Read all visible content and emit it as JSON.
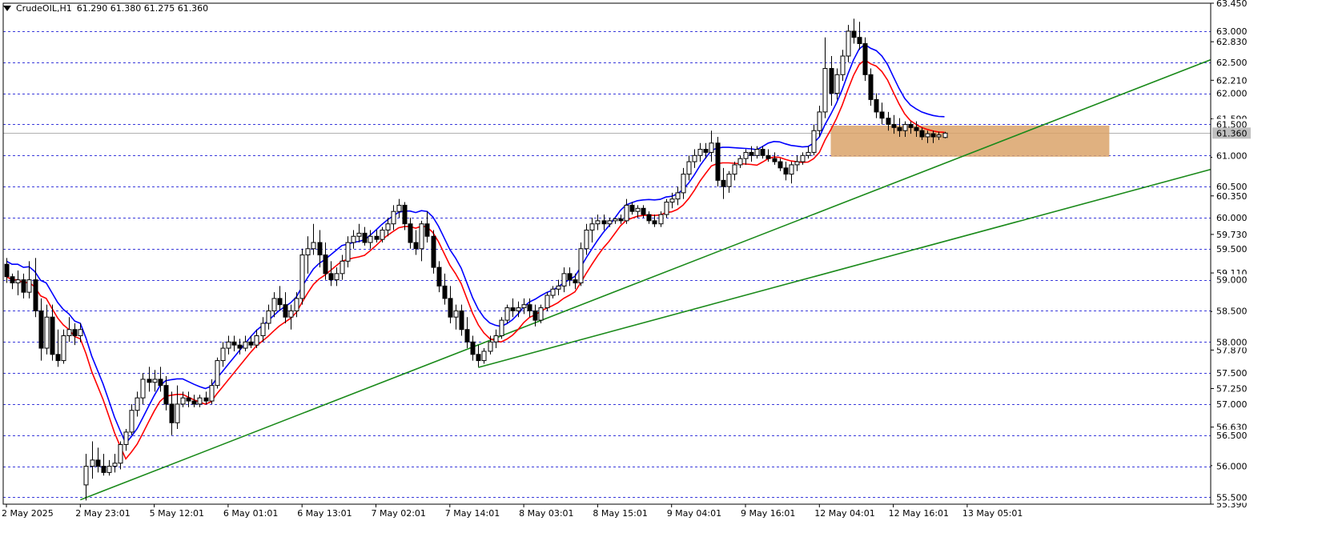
{
  "header": {
    "symbol": "CrudeOIL,H1",
    "ohlc": "61.290 61.380 61.275 61.360"
  },
  "chart_data": {
    "type": "candlestick",
    "ylim": [
      55.39,
      63.45
    ],
    "current_price": "61.360",
    "y_ticks": [
      "63.450",
      "62.830",
      "62.210",
      "61.590",
      "60.970",
      "60.350",
      "59.730",
      "59.110",
      "58.490",
      "57.870",
      "57.250",
      "56.630",
      "56.010",
      "55.390"
    ],
    "levels": [
      "63.000",
      "62.500",
      "62.000",
      "61.500",
      "61.000",
      "60.500",
      "60.000",
      "59.500",
      "59.000",
      "58.500",
      "58.000",
      "57.500",
      "57.000",
      "56.500",
      "56.000",
      "55.500"
    ],
    "x_labels": [
      "2 May 2025",
      "2 May 23:01",
      "5 May 12:01",
      "6 May 01:01",
      "6 May 13:01",
      "7 May 02:01",
      "7 May 14:01",
      "8 May 03:01",
      "8 May 15:01",
      "9 May 04:01",
      "9 May 16:01",
      "12 May 04:01",
      "12 May 16:01",
      "13 May 05:01"
    ],
    "x_label_bars": [
      0,
      13,
      26,
      39,
      52,
      65,
      78,
      91,
      104,
      117,
      130,
      143,
      156,
      169
    ],
    "candles": [
      [
        59.25,
        59.35,
        58.95,
        59.05
      ],
      [
        59.05,
        59.1,
        58.85,
        58.95
      ],
      [
        58.95,
        59.15,
        58.75,
        59.0
      ],
      [
        59.0,
        59.1,
        58.7,
        58.8
      ],
      [
        58.8,
        59.3,
        58.7,
        59.0
      ],
      [
        59.0,
        59.35,
        58.4,
        58.5
      ],
      [
        58.5,
        58.7,
        57.7,
        57.9
      ],
      [
        57.9,
        58.6,
        57.8,
        58.4
      ],
      [
        58.4,
        58.6,
        57.7,
        57.8
      ],
      [
        57.8,
        58.2,
        57.6,
        57.7
      ],
      [
        57.7,
        58.2,
        57.65,
        58.1
      ],
      [
        58.1,
        58.4,
        58.0,
        58.2
      ],
      [
        58.2,
        58.3,
        57.95,
        58.1
      ],
      [
        58.1,
        58.3,
        58.0,
        58.2
      ],
      [
        55.7,
        56.2,
        55.45,
        56.0
      ],
      [
        56.0,
        56.4,
        55.8,
        56.1
      ],
      [
        56.1,
        56.3,
        55.9,
        56.0
      ],
      [
        56.0,
        56.2,
        55.85,
        55.9
      ],
      [
        55.9,
        56.1,
        55.85,
        56.0
      ],
      [
        56.0,
        56.2,
        55.9,
        56.05
      ],
      [
        56.05,
        56.4,
        55.95,
        56.35
      ],
      [
        56.35,
        56.6,
        56.25,
        56.55
      ],
      [
        56.55,
        57.0,
        56.5,
        56.9
      ],
      [
        56.9,
        57.2,
        56.8,
        57.1
      ],
      [
        57.1,
        57.5,
        57.0,
        57.4
      ],
      [
        57.4,
        57.6,
        57.2,
        57.35
      ],
      [
        57.35,
        57.55,
        57.2,
        57.4
      ],
      [
        57.4,
        57.6,
        57.2,
        57.3
      ],
      [
        57.3,
        57.45,
        56.9,
        57.0
      ],
      [
        57.0,
        57.2,
        56.5,
        56.7
      ],
      [
        56.7,
        57.3,
        56.6,
        57.0
      ],
      [
        57.0,
        57.2,
        56.95,
        57.1
      ],
      [
        57.1,
        57.2,
        56.95,
        57.05
      ],
      [
        57.05,
        57.15,
        56.95,
        57.0
      ],
      [
        57.0,
        57.15,
        56.95,
        57.1
      ],
      [
        57.1,
        57.2,
        57.0,
        57.05
      ],
      [
        57.05,
        57.4,
        57.0,
        57.3
      ],
      [
        57.3,
        57.75,
        57.25,
        57.7
      ],
      [
        57.7,
        58.0,
        57.6,
        57.9
      ],
      [
        57.9,
        58.1,
        57.8,
        58.0
      ],
      [
        58.0,
        58.1,
        57.85,
        57.95
      ],
      [
        57.95,
        58.05,
        57.8,
        57.9
      ],
      [
        57.9,
        58.1,
        57.85,
        58.0
      ],
      [
        58.0,
        58.1,
        57.9,
        57.95
      ],
      [
        57.95,
        58.2,
        57.9,
        58.1
      ],
      [
        58.1,
        58.4,
        58.0,
        58.3
      ],
      [
        58.3,
        58.6,
        58.2,
        58.5
      ],
      [
        58.5,
        58.8,
        58.4,
        58.7
      ],
      [
        58.7,
        58.9,
        58.5,
        58.6
      ],
      [
        58.6,
        58.8,
        58.3,
        58.4
      ],
      [
        58.4,
        58.6,
        58.2,
        58.5
      ],
      [
        58.5,
        58.8,
        58.4,
        58.7
      ],
      [
        58.7,
        59.5,
        58.6,
        59.4
      ],
      [
        59.4,
        59.7,
        59.1,
        59.5
      ],
      [
        59.5,
        59.9,
        59.4,
        59.6
      ],
      [
        59.6,
        59.8,
        59.2,
        59.4
      ],
      [
        59.4,
        59.6,
        59.0,
        59.1
      ],
      [
        59.1,
        59.3,
        58.9,
        59.0
      ],
      [
        59.0,
        59.2,
        58.9,
        59.1
      ],
      [
        59.1,
        59.4,
        59.0,
        59.3
      ],
      [
        59.3,
        59.7,
        59.2,
        59.6
      ],
      [
        59.6,
        59.8,
        59.5,
        59.7
      ],
      [
        59.7,
        59.9,
        59.6,
        59.75
      ],
      [
        59.75,
        59.85,
        59.55,
        59.6
      ],
      [
        59.6,
        59.8,
        59.5,
        59.7
      ],
      [
        59.7,
        59.8,
        59.6,
        59.65
      ],
      [
        59.65,
        59.85,
        59.6,
        59.8
      ],
      [
        59.8,
        60.0,
        59.7,
        59.9
      ],
      [
        59.9,
        60.2,
        59.8,
        60.1
      ],
      [
        60.1,
        60.3,
        60.0,
        60.2
      ],
      [
        60.2,
        60.25,
        59.8,
        59.9
      ],
      [
        59.9,
        60.0,
        59.5,
        59.6
      ],
      [
        59.6,
        59.8,
        59.4,
        59.5
      ],
      [
        59.5,
        59.95,
        59.3,
        59.9
      ],
      [
        59.9,
        60.1,
        59.6,
        59.7
      ],
      [
        59.7,
        59.8,
        59.1,
        59.2
      ],
      [
        59.2,
        59.3,
        58.8,
        58.9
      ],
      [
        58.9,
        59.1,
        58.6,
        58.7
      ],
      [
        58.7,
        58.9,
        58.3,
        58.4
      ],
      [
        58.4,
        58.6,
        58.2,
        58.5
      ],
      [
        58.5,
        58.6,
        58.1,
        58.2
      ],
      [
        58.2,
        58.4,
        57.9,
        58.0
      ],
      [
        58.0,
        58.1,
        57.7,
        57.8
      ],
      [
        57.8,
        57.95,
        57.6,
        57.7
      ],
      [
        57.7,
        57.9,
        57.65,
        57.85
      ],
      [
        57.85,
        58.1,
        57.8,
        58.0
      ],
      [
        58.0,
        58.2,
        57.9,
        58.1
      ],
      [
        58.1,
        58.4,
        58.05,
        58.35
      ],
      [
        58.35,
        58.6,
        58.3,
        58.55
      ],
      [
        58.55,
        58.7,
        58.4,
        58.5
      ],
      [
        58.5,
        58.65,
        58.4,
        58.55
      ],
      [
        58.55,
        58.7,
        58.45,
        58.6
      ],
      [
        58.6,
        58.7,
        58.4,
        58.5
      ],
      [
        58.5,
        58.6,
        58.25,
        58.35
      ],
      [
        58.35,
        58.6,
        58.3,
        58.55
      ],
      [
        58.55,
        58.8,
        58.5,
        58.75
      ],
      [
        58.75,
        58.9,
        58.7,
        58.85
      ],
      [
        58.85,
        59.0,
        58.75,
        58.9
      ],
      [
        58.9,
        59.2,
        58.8,
        59.1
      ],
      [
        59.1,
        59.2,
        58.9,
        59.0
      ],
      [
        59.0,
        59.1,
        58.85,
        58.95
      ],
      [
        58.95,
        59.6,
        58.9,
        59.5
      ],
      [
        59.5,
        59.9,
        59.4,
        59.8
      ],
      [
        59.8,
        60.0,
        59.6,
        59.9
      ],
      [
        59.9,
        60.05,
        59.8,
        59.95
      ],
      [
        59.95,
        60.05,
        59.8,
        59.9
      ],
      [
        59.9,
        60.0,
        59.85,
        59.95
      ],
      [
        59.95,
        60.0,
        59.9,
        59.98
      ],
      [
        59.98,
        60.05,
        59.9,
        59.95
      ],
      [
        59.95,
        60.3,
        59.9,
        60.2
      ],
      [
        60.2,
        60.25,
        60.05,
        60.1
      ],
      [
        60.1,
        60.2,
        60.0,
        60.15
      ],
      [
        60.15,
        60.2,
        60.0,
        60.05
      ],
      [
        60.05,
        60.1,
        59.9,
        59.95
      ],
      [
        59.95,
        60.05,
        59.85,
        59.9
      ],
      [
        59.9,
        60.1,
        59.85,
        60.05
      ],
      [
        60.05,
        60.3,
        60.0,
        60.25
      ],
      [
        60.25,
        60.4,
        60.15,
        60.3
      ],
      [
        60.3,
        60.5,
        60.2,
        60.4
      ],
      [
        60.4,
        60.8,
        60.3,
        60.7
      ],
      [
        60.7,
        61.0,
        60.6,
        60.9
      ],
      [
        60.9,
        61.1,
        60.8,
        61.0
      ],
      [
        61.0,
        61.2,
        60.9,
        61.1
      ],
      [
        61.1,
        61.2,
        60.95,
        61.05
      ],
      [
        61.05,
        61.4,
        60.9,
        61.2
      ],
      [
        61.2,
        61.3,
        60.5,
        60.6
      ],
      [
        60.6,
        60.8,
        60.3,
        60.5
      ],
      [
        60.5,
        60.75,
        60.4,
        60.7
      ],
      [
        60.7,
        60.9,
        60.6,
        60.85
      ],
      [
        60.85,
        61.0,
        60.8,
        60.95
      ],
      [
        60.95,
        61.1,
        60.85,
        61.05
      ],
      [
        61.05,
        61.15,
        60.9,
        61.0
      ],
      [
        61.0,
        61.15,
        60.95,
        61.1
      ],
      [
        61.1,
        61.15,
        60.95,
        61.0
      ],
      [
        61.0,
        61.1,
        60.9,
        60.95
      ],
      [
        60.95,
        61.05,
        60.85,
        60.9
      ],
      [
        60.9,
        60.95,
        60.75,
        60.8
      ],
      [
        60.8,
        60.9,
        60.6,
        60.7
      ],
      [
        60.7,
        60.9,
        60.55,
        60.85
      ],
      [
        60.85,
        61.0,
        60.75,
        60.9
      ],
      [
        60.9,
        61.05,
        60.85,
        61.0
      ],
      [
        61.0,
        61.15,
        60.95,
        61.05
      ],
      [
        61.05,
        61.5,
        61.0,
        61.4
      ],
      [
        61.4,
        61.8,
        61.3,
        61.7
      ],
      [
        61.7,
        62.9,
        61.6,
        62.4
      ],
      [
        62.4,
        62.6,
        61.8,
        62.0
      ],
      [
        62.0,
        62.4,
        61.9,
        62.3
      ],
      [
        62.3,
        62.7,
        62.2,
        62.6
      ],
      [
        62.6,
        63.1,
        62.5,
        63.0
      ],
      [
        63.0,
        63.2,
        62.8,
        62.9
      ],
      [
        62.9,
        63.15,
        62.7,
        62.8
      ],
      [
        62.8,
        62.9,
        62.2,
        62.3
      ],
      [
        62.3,
        62.4,
        61.8,
        61.9
      ],
      [
        61.9,
        62.0,
        61.6,
        61.7
      ],
      [
        61.7,
        61.85,
        61.5,
        61.6
      ],
      [
        61.6,
        61.7,
        61.4,
        61.5
      ],
      [
        61.5,
        61.65,
        61.35,
        61.45
      ],
      [
        61.45,
        61.6,
        61.3,
        61.4
      ],
      [
        61.4,
        61.55,
        61.3,
        61.5
      ],
      [
        61.5,
        61.55,
        61.35,
        61.45
      ],
      [
        61.45,
        61.55,
        61.3,
        61.4
      ],
      [
        61.4,
        61.45,
        61.25,
        61.3
      ],
      [
        61.3,
        61.4,
        61.2,
        61.35
      ],
      [
        61.35,
        61.4,
        61.2,
        61.3
      ],
      [
        61.3,
        61.38,
        61.25,
        61.33
      ],
      [
        61.29,
        61.38,
        61.275,
        61.36
      ]
    ],
    "zone": {
      "x_from_bar": 145,
      "x_to_bar": 194,
      "y_top": 61.48,
      "y_bottom": 60.98,
      "color": "#dba36a"
    },
    "trendlines": [
      {
        "from": {
          "bar": 13,
          "price": 55.46
        },
        "to": {
          "bar": 250,
          "price": 63.9
        },
        "color": "#1a8a1a"
      },
      {
        "from": {
          "bar": 83,
          "price": 57.59
        },
        "to": {
          "bar": 250,
          "price": 61.72
        },
        "color": "#1a8a1a"
      }
    ],
    "series": [
      {
        "type": "ma",
        "period": 8,
        "color": "#ff0000"
      },
      {
        "type": "ma",
        "period": 8,
        "shift": 1,
        "color": "#0000ff"
      }
    ],
    "colors": {
      "grid": "#3a3adb",
      "candle_up_fill": "#ffffff",
      "candle_down_fill": "#000000",
      "candle_border": "#000000"
    }
  }
}
